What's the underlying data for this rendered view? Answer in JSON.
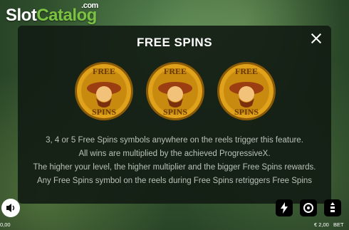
{
  "logo": {
    "part1": "Slot",
    "part2": "Catalog",
    "suffix": ".com"
  },
  "modal": {
    "title": "FREE SPINS",
    "coin_label_top": "FREE",
    "coin_label_bottom": "SPINS",
    "paragraphs": [
      "3, 4 or 5 Free Spins symbols anywhere on the reels trigger this feature.",
      "All wins are multiplied by the achieved ProgressiveX.",
      "The higher your level, the higher multiplier and the bigger Free Spins rewards.",
      "Any Free Spins symbol on the reels during Free Spins retriggers Free Spins"
    ]
  },
  "footer": {
    "left_value": "0,00",
    "bet_value": "€ 2,00",
    "bet_label": "BET"
  },
  "colors": {
    "accent": "#7cc242",
    "coin_gold": "#e0a21a"
  }
}
